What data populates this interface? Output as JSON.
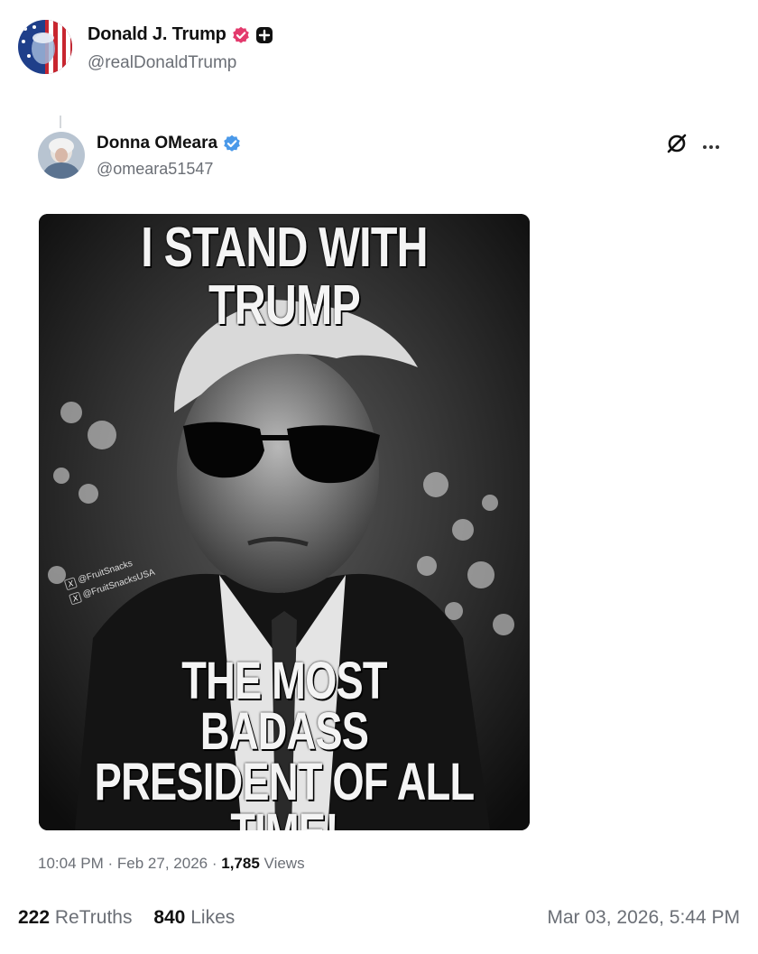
{
  "author": {
    "display_name": "Donald J. Trump",
    "handle": "@realDonaldTrump"
  },
  "quoted_post": {
    "display_name": "Donna OMeara",
    "handle": "@omeara51547",
    "image_text": {
      "top": "I STAND WITH TRUMP",
      "bottom_line1": "THE MOST BADASS",
      "bottom_line2": "PRESIDENT OF ALL",
      "bottom_line3": "TIME!",
      "watermark1": "@FruitSnacks",
      "watermark2": "@FruitSnacksUSA"
    },
    "time": "10:04 PM",
    "separator": "·",
    "date": "Feb 27, 2026",
    "views_count": "1,785",
    "views_label": "Views"
  },
  "stats": {
    "retruths_count": "222",
    "retruths_label": "ReTruths",
    "likes_count": "840",
    "likes_label": "Likes",
    "posted_at": "Mar 03, 2026, 5:44 PM"
  },
  "colors": {
    "verified_pink": "#e33b6d",
    "verified_blue": "#4a99e9",
    "muted_text": "#6b6f76"
  }
}
